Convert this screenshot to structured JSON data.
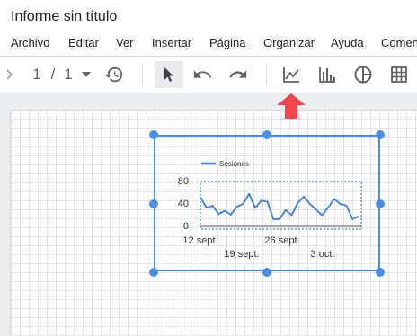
{
  "document": {
    "title": "Informe sin título"
  },
  "menu": [
    "Archivo",
    "Editar",
    "Ver",
    "Insertar",
    "Página",
    "Organizar",
    "Ayuda",
    "Comen"
  ],
  "toolbar": {
    "page_current": "1",
    "page_sep": "/",
    "page_total": "1"
  },
  "chart_data": {
    "type": "line",
    "legend": "Sesiones",
    "legend_position": "top-left",
    "yticks": [
      "80",
      "40",
      "0"
    ],
    "ylim": [
      0,
      80
    ],
    "xticks_row1": [
      "12 sept.",
      "26 sept."
    ],
    "xticks_row2": [
      "19 sept.",
      "3 oct."
    ],
    "series": [
      {
        "name": "Sesiones",
        "color": "#4a86d6",
        "values": [
          52,
          33,
          37,
          22,
          28,
          21,
          35,
          40,
          58,
          33,
          46,
          44,
          13,
          13,
          29,
          20,
          42,
          53,
          40,
          30,
          20,
          34,
          49,
          40,
          37,
          13,
          18
        ]
      }
    ]
  },
  "colors": {
    "selection": "#4a90e2",
    "arrow": "#f2474d"
  }
}
